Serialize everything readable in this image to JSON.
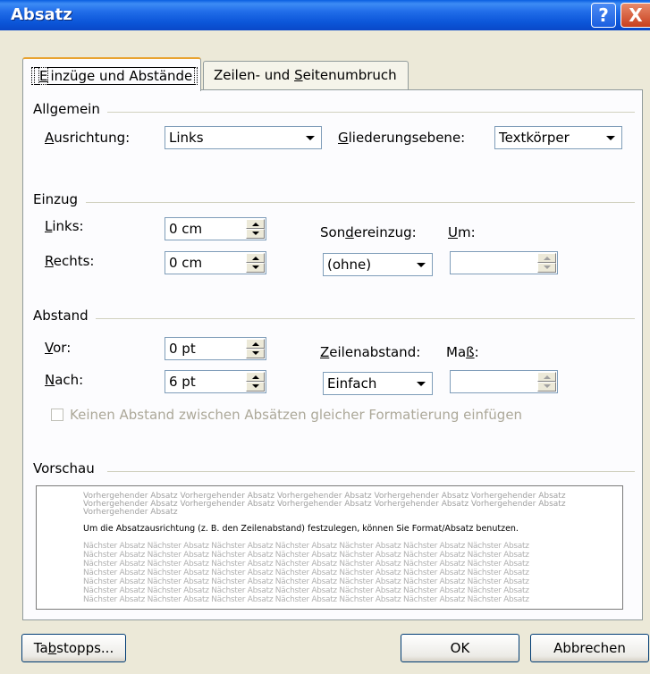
{
  "window": {
    "title": "Absatz",
    "help_symbol": "?",
    "close_symbol": "X"
  },
  "tabs": [
    {
      "label_pre": "",
      "accel": "E",
      "label_post": "inzüge und Abstände"
    },
    {
      "label_pre": "Zeilen- und ",
      "accel": "S",
      "label_post": "eitenumbruch"
    }
  ],
  "allgemein": {
    "heading": "Allgemein",
    "ausrichtung": {
      "accel": "A",
      "rest": "usrichtung:",
      "value": "Links"
    },
    "gliederung": {
      "accel": "G",
      "rest": "liederungsebene:",
      "value": "Textkörper"
    }
  },
  "einzug": {
    "heading": "Einzug",
    "links": {
      "accel": "L",
      "rest": "inks:",
      "value": "0 cm"
    },
    "rechts": {
      "accel": "R",
      "rest": "echts:",
      "value": "0 cm"
    },
    "sonder": {
      "pre": "Son",
      "accel": "d",
      "post": "ereinzug:",
      "value": "(ohne)"
    },
    "um": {
      "accel": "U",
      "rest": "m:",
      "value": ""
    }
  },
  "abstand": {
    "heading": "Abstand",
    "vor": {
      "accel": "V",
      "rest": "or:",
      "value": "0 pt"
    },
    "nach": {
      "accel": "N",
      "rest": "ach:",
      "value": "6 pt"
    },
    "zeilen": {
      "accel": "Z",
      "rest": "eilenabstand:",
      "value": "Einfach"
    },
    "mass": {
      "pre": "Ma",
      "accel": "ß",
      "post": ":",
      "value": ""
    },
    "checkbox_label": "Keinen Abstand zwischen Absätzen gleicher Formatierung einfügen",
    "checkbox_checked": false
  },
  "vorschau": {
    "heading": "Vorschau",
    "prev_lines": [
      "Vorhergehender Absatz Vorhergehender Absatz Vorhergehender Absatz Vorhergehender Absatz Vorhergehender Absatz",
      "Vorhergehender Absatz Vorhergehender Absatz Vorhergehender Absatz Vorhergehender Absatz Vorhergehender Absatz",
      "Vorhergehender Absatz"
    ],
    "current_line": "Um die Absatzausrichtung (z. B. den Zeilenabstand) festzulegen, können Sie Format/Absatz benutzen.",
    "next_lines": [
      "Nächster Absatz Nächster Absatz Nächster Absatz Nächster Absatz Nächster Absatz Nächster Absatz Nächster Absatz",
      "Nächster Absatz Nächster Absatz Nächster Absatz Nächster Absatz Nächster Absatz Nächster Absatz Nächster Absatz",
      "Nächster Absatz Nächster Absatz Nächster Absatz Nächster Absatz Nächster Absatz Nächster Absatz Nächster Absatz",
      "Nächster Absatz Nächster Absatz Nächster Absatz Nächster Absatz Nächster Absatz Nächster Absatz Nächster Absatz",
      "Nächster Absatz Nächster Absatz Nächster Absatz Nächster Absatz Nächster Absatz Nächster Absatz Nächster Absatz",
      "Nächster Absatz Nächster Absatz Nächster Absatz Nächster Absatz Nächster Absatz Nächster Absatz Nächster Absatz",
      "Nächster Absatz Nächster Absatz Nächster Absatz Nächster Absatz Nächster Absatz Nächster Absatz Nächster Absatz"
    ]
  },
  "buttons": {
    "tabstopps": {
      "pre": "Ta",
      "accel": "b",
      "post": "stopps..."
    },
    "ok": "OK",
    "cancel": "Abbrechen"
  }
}
